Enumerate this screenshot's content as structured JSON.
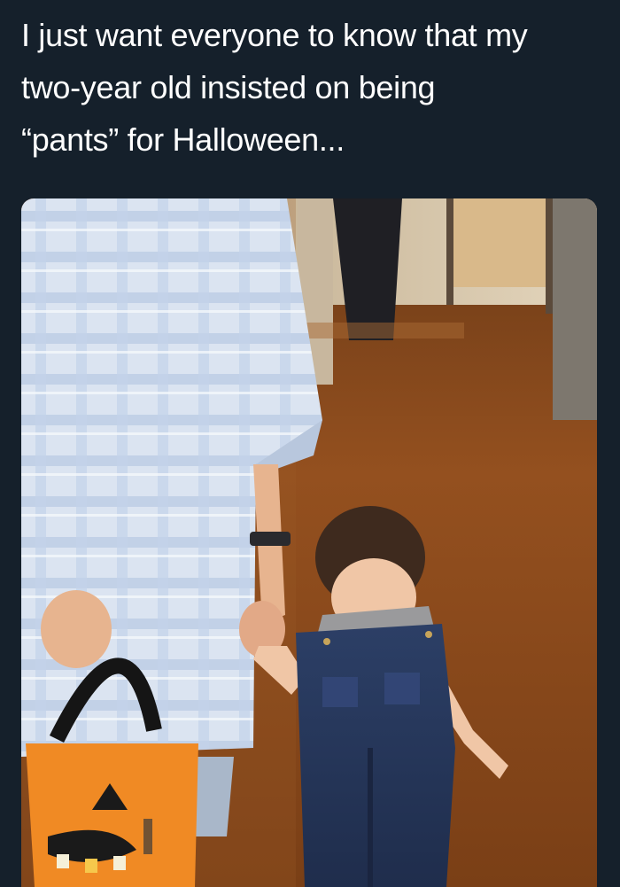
{
  "tweet": {
    "text_lines": [
      "I just want everyone to know that my",
      "two-year old insisted on being",
      "“pants” for Halloween..."
    ]
  },
  "media": {
    "description_icon": "photo-image",
    "colors": {
      "background": "#15202b",
      "text": "#ffffff",
      "floor": "#8a4a1c",
      "shirt": "#cfdcec",
      "overalls": "#2b3d63",
      "bag": "#f08a24"
    }
  }
}
